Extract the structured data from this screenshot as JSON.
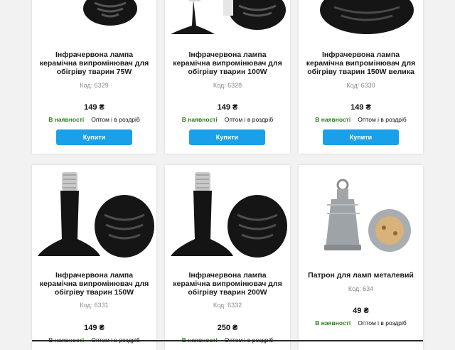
{
  "colors": {
    "accent": "#1aa0e8",
    "in_stock": "#2e7d1f"
  },
  "products": [
    {
      "title": "Інфрачервона лампа керамічна випромінювач для обігріву тварин 75W",
      "code": "Код: 6329",
      "price": "149 ₴",
      "stock": "В наявності",
      "sale": "Оптом і в роздріб",
      "buy": "Купити",
      "image": "ceramic-lamp-image"
    },
    {
      "title": "Інфрачервона лампа керамічна випромінювач для обігріву тварин 100W",
      "code": "Код: 6328",
      "price": "149 ₴",
      "stock": "В наявності",
      "sale": "Оптом і в роздріб",
      "buy": "Купити",
      "image": "ceramic-lamp-image"
    },
    {
      "title": "Інфрачервона лампа керамічна випромінювач для обігріву тварин 150W велика",
      "code": "Код: 6330",
      "price": "149 ₴",
      "stock": "В наявності",
      "sale": "Оптом і в роздріб",
      "buy": "Купити",
      "image": "ceramic-lamp-image"
    },
    {
      "title": "Інфрачервона лампа керамічна випромінювач для обігріву тварин 150W",
      "code": "Код: 6331",
      "price": "149 ₴",
      "stock": "В наявності",
      "sale": "Оптом і в роздріб",
      "image": "ceramic-lamp-image"
    },
    {
      "title": "Інфрачервона лампа керамічна випромінювач для обігріву тварин 200W",
      "code": "Код: 6332",
      "price": "250 ₴",
      "stock": "В наявності",
      "sale": "Оптом і в роздріб",
      "image": "ceramic-lamp-image"
    },
    {
      "title": "Патрон для ламп металевий",
      "code": "Код: 634",
      "price": "49 ₴",
      "stock": "В наявності",
      "sale": "Оптом і в роздріб",
      "image": "metal-socket-image"
    }
  ]
}
